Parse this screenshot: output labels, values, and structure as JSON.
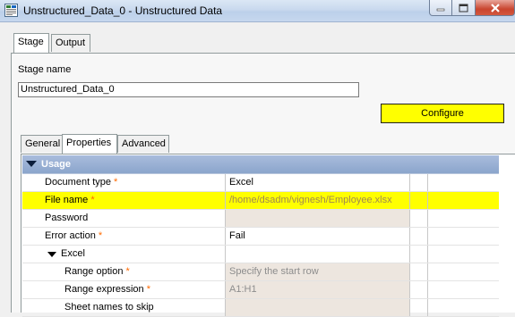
{
  "window": {
    "title": "Unstructured_Data_0 - Unstructured Data"
  },
  "outer_tabs": [
    "Stage",
    "Output"
  ],
  "stage": {
    "label": "Stage name",
    "value": "Unstructured_Data_0"
  },
  "configure_label": "Configure",
  "inner_tabs": [
    "General",
    "Properties",
    "Advanced"
  ],
  "section": "Usage",
  "properties": [
    {
      "name": "Document type",
      "required": true,
      "value": "Excel"
    },
    {
      "name": "File name",
      "required": true,
      "value": "/home/dsadm/vignesh/Employee.xlsx"
    },
    {
      "name": "Password",
      "required": false,
      "value": ""
    },
    {
      "name": "Error action",
      "required": true,
      "value": "Fail"
    },
    {
      "name": "Excel",
      "required": false,
      "value": ""
    },
    {
      "name": "Range option",
      "required": true,
      "value": "Specify the start row"
    },
    {
      "name": "Range expression",
      "required": true,
      "value": "A1:H1"
    },
    {
      "name": "Sheet names to skip",
      "required": false,
      "value": ""
    }
  ],
  "required_marker": "*",
  "colors": {
    "configure_bg": "#ffff00",
    "highlight_row": "#ffff00",
    "header_bg": "#95acd2",
    "required": "#ff6a00"
  }
}
